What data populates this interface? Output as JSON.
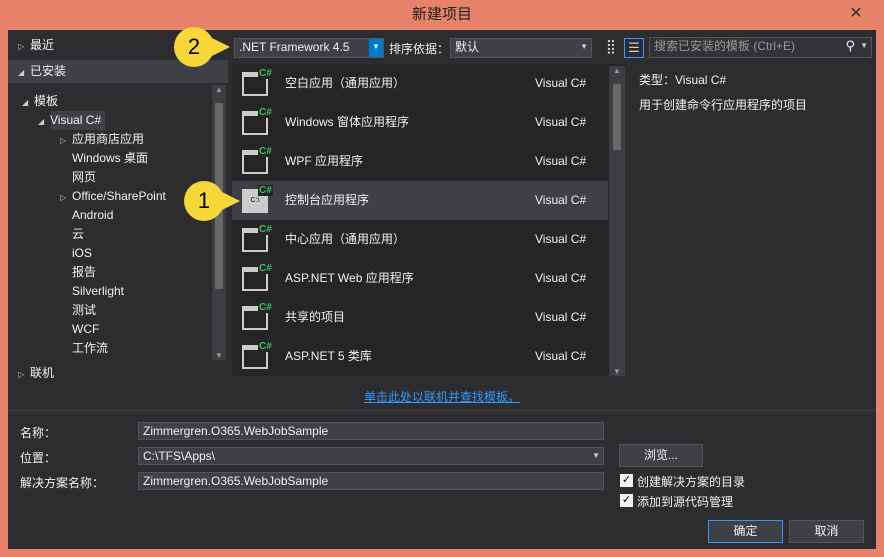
{
  "window": {
    "title": "新建项目",
    "close": "✕"
  },
  "toolbar": {
    "framework": ".NET Framework 4.5",
    "sort_label": "排序依据：",
    "sort_value": "默认",
    "search_placeholder": "搜索已安装的模板 (Ctrl+E)"
  },
  "tree": {
    "recent": "最近",
    "installed": "已安装",
    "templates": "模板",
    "visual_csharp": "Visual C#",
    "children": [
      "应用商店应用",
      "Windows 桌面",
      "网页",
      "Office/SharePoint",
      "Android",
      "云",
      "iOS",
      "报告",
      "Silverlight",
      "测试",
      "WCF",
      "工作流"
    ],
    "online": "联机"
  },
  "templates": [
    {
      "name": "空白应用（通用应用）",
      "lang": "Visual C#"
    },
    {
      "name": "Windows 窗体应用程序",
      "lang": "Visual C#"
    },
    {
      "name": "WPF 应用程序",
      "lang": "Visual C#"
    },
    {
      "name": "控制台应用程序",
      "lang": "Visual C#",
      "icon_text": "C:\\"
    },
    {
      "name": "中心应用（通用应用）",
      "lang": "Visual C#"
    },
    {
      "name": "ASP.NET Web 应用程序",
      "lang": "Visual C#"
    },
    {
      "name": "共享的项目",
      "lang": "Visual C#"
    },
    {
      "name": "ASP.NET 5 类库",
      "lang": "Visual C#"
    }
  ],
  "details": {
    "type": "类型：Visual C#",
    "description": "用于创建命令行应用程序的项目"
  },
  "online_link": "单击此处以联机并查找模板。",
  "form": {
    "name_label": "名称：",
    "name_value": "Zimmergren.O365.WebJobSample",
    "location_label": "位置：",
    "location_value": "C:\\TFS\\Apps\\",
    "solution_label": "解决方案名称：",
    "solution_value": "Zimmergren.O365.WebJobSample",
    "browse": "浏览...",
    "create_dir": "创建解决方案的目录",
    "add_source": "添加到源代码管理",
    "ok": "确定",
    "cancel": "取消"
  },
  "callouts": {
    "one": "1",
    "two": "2"
  }
}
